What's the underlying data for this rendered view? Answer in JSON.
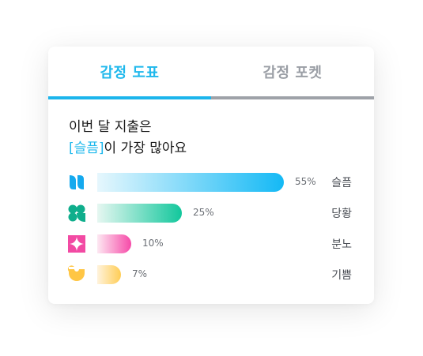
{
  "tabs": [
    {
      "label": "감정 도표",
      "active": true
    },
    {
      "label": "감정 포켓",
      "active": false
    }
  ],
  "headline": {
    "line1": "이번 달 지출은",
    "highlight": "[슬픔]",
    "line2_rest": "이 가장 많아요"
  },
  "colors": {
    "accent": "#1fb8ec",
    "inactive_tab": "#9ea2a8"
  },
  "emotions": [
    {
      "name": "슬픔",
      "percent_label": "55%",
      "value": 55,
      "icon": "sadness-icon",
      "color_from": "#e6f7fd",
      "color_to": "#14b9f5"
    },
    {
      "name": "당황",
      "percent_label": "25%",
      "value": 25,
      "icon": "embarrassment-icon",
      "color_from": "#e6f7f1",
      "color_to": "#12c79c"
    },
    {
      "name": "분노",
      "percent_label": "10%",
      "value": 10,
      "icon": "anger-icon",
      "color_from": "#fde8f2",
      "color_to": "#f64aa8"
    },
    {
      "name": "기쁨",
      "percent_label": "7%",
      "value": 7,
      "icon": "joy-icon",
      "color_from": "#fff3dc",
      "color_to": "#ffcd55"
    }
  ]
}
